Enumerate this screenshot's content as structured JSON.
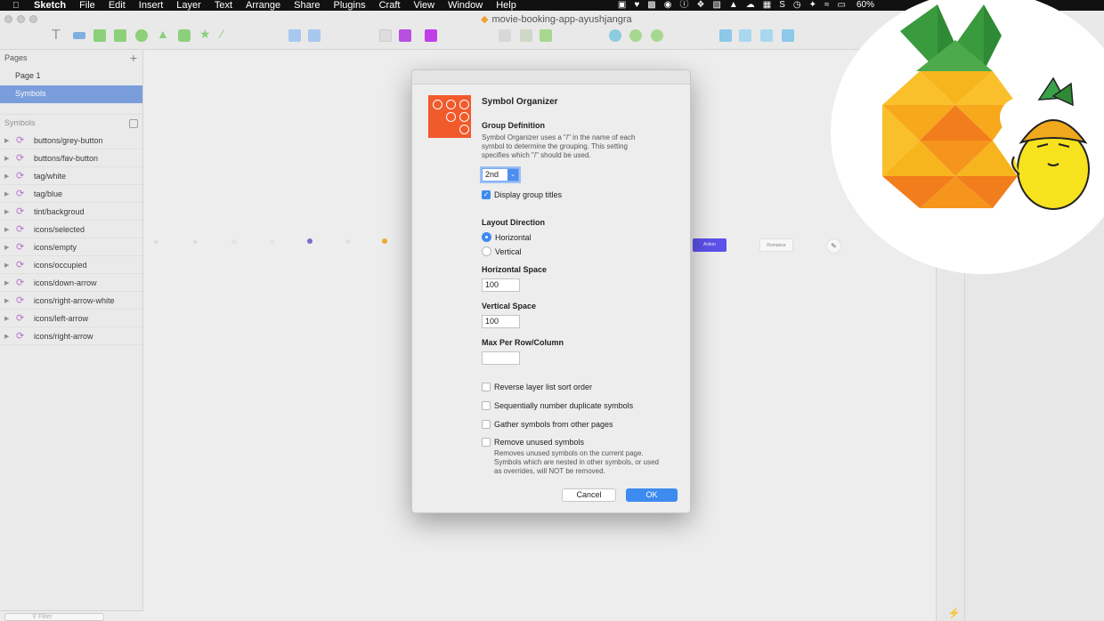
{
  "menubar": {
    "app": "Sketch",
    "items": [
      "File",
      "Edit",
      "Insert",
      "Layer",
      "Text",
      "Arrange",
      "Share",
      "Plugins",
      "Craft",
      "View",
      "Window",
      "Help"
    ],
    "battery": "60%"
  },
  "window": {
    "title": "movie-booking-app-ayushjangra"
  },
  "sidebar": {
    "pages_header": "Pages",
    "pages": [
      "Page 1",
      "Symbols"
    ],
    "selected_page": "Symbols",
    "symbols_header": "Symbols",
    "symbols": [
      "buttons/grey-button",
      "buttons/fav-button",
      "tag/white",
      "tag/blue",
      "tint/backgroud",
      "icons/selected",
      "icons/empty",
      "icons/occupied",
      "icons/down-arrow",
      "icons/right-arrow-white",
      "icons/left-arrow",
      "icons/right-arrow"
    ],
    "filter_placeholder": "Filter"
  },
  "canvas": {
    "button_blue": "Action",
    "button_white": "Romance"
  },
  "dialog": {
    "title": "Symbol Organizer",
    "group_definition": {
      "heading": "Group Definition",
      "description": "Symbol Organizer uses a \"/\" in the name of each symbol to determine the grouping. This setting specifies which \"/\" should be used.",
      "selected": "2nd",
      "display_titles_label": "Display group titles",
      "display_titles_checked": true
    },
    "layout_direction": {
      "heading": "Layout Direction",
      "options": [
        "Horizontal",
        "Vertical"
      ],
      "selected": "Horizontal"
    },
    "horizontal_space": {
      "heading": "Horizontal Space",
      "value": "100"
    },
    "vertical_space": {
      "heading": "Vertical Space",
      "value": "100"
    },
    "max_per_row": {
      "heading": "Max Per Row/Column",
      "value": ""
    },
    "options": [
      {
        "label": "Reverse layer list sort order",
        "checked": false
      },
      {
        "label": "Sequentially number duplicate symbols",
        "checked": false
      },
      {
        "label": "Gather symbols from other pages",
        "checked": false
      },
      {
        "label": "Remove unused symbols",
        "checked": false
      }
    ],
    "remove_unused_description": "Removes unused symbols on the current page. Symbols which are nested in other symbols, or used as overrides, will NOT be removed.",
    "cancel_label": "Cancel",
    "ok_label": "OK"
  },
  "colors": {
    "accent_blue": "#3d8af0",
    "plugin_orange": "#f15a2b",
    "selected_page": "#6d97e0",
    "canvas_button_blue": "#4a3cf0"
  }
}
